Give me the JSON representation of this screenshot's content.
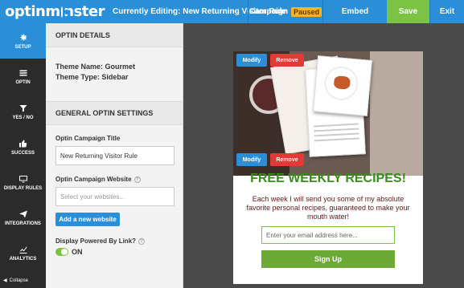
{
  "app": {
    "logo_text_pre": "optinm",
    "logo_text_post": "nster"
  },
  "topbar": {
    "editing_label": "Currently Editing: New Returning Visitor Rule",
    "campaign_label": "Campaign",
    "paused_badge": "Paused",
    "embed_label": "Embed",
    "save_label": "Save",
    "exit_label": "Exit"
  },
  "nav": {
    "items": [
      {
        "label": "SETUP",
        "icon": "gear-icon"
      },
      {
        "label": "OPTIN",
        "icon": "menu-icon"
      },
      {
        "label": "YES / NO",
        "icon": "filter-icon"
      },
      {
        "label": "SUCCESS",
        "icon": "thumbs-up-icon"
      },
      {
        "label": "DISPLAY RULES",
        "icon": "monitor-icon"
      },
      {
        "label": "INTEGRATIONS",
        "icon": "paper-plane-icon"
      },
      {
        "label": "ANALYTICS",
        "icon": "chart-icon"
      }
    ],
    "collapse_label": "Collapse"
  },
  "panel": {
    "optin_details_title": "OPTIN DETAILS",
    "theme_name": "Theme Name: Gourmet",
    "theme_type": "Theme Type: Sidebar",
    "general_title": "GENERAL OPTIN SETTINGS",
    "campaign_title_label": "Optin Campaign Title",
    "campaign_title_value": "New Returning Visitor Rule",
    "website_label": "Optin Campaign Website",
    "website_placeholder": "Select your websites...",
    "add_website_label": "Add a new website",
    "powered_by_label": "Display Powered By Link?",
    "toggle_state": "ON"
  },
  "preview": {
    "modify_label": "Modify",
    "remove_label": "Remove",
    "headline": "FREE WEEKLY RECIPES!",
    "subtext": "Each week I will send you some of my absolute favorite personal recipes, guaranteed to make your mouth water!",
    "email_placeholder": "Enter your email address here...",
    "signup_label": "Sign Up"
  },
  "colors": {
    "primary": "#2a8fd6",
    "save_green": "#7cc244",
    "remove_red": "#e53935",
    "headline_green": "#3a8a1e",
    "paused_yellow": "#f3b527"
  }
}
